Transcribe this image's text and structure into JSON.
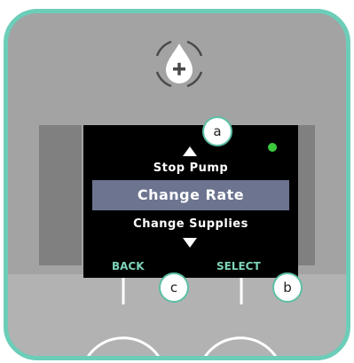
{
  "screen": {
    "menu_prev": "Stop Pump",
    "menu_current": "Change Rate",
    "menu_next": "Change Supplies",
    "softkey_left_label": "BACK",
    "softkey_right_label": "SELECT",
    "status_led_color": "#3cc93c"
  },
  "callouts": {
    "a": "a",
    "b": "b",
    "c": "c"
  },
  "device": {
    "bezel_color": "#6ccdb8",
    "drop_button_icon": "water-drop-plus-icon"
  }
}
